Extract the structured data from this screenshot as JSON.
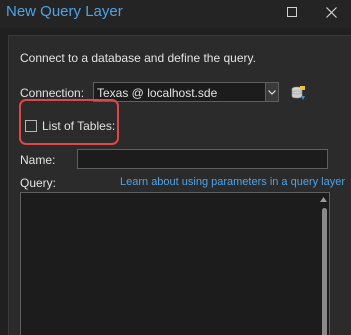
{
  "window": {
    "title": "New Query Layer"
  },
  "intro": {
    "text": "Connect to a database and define the query."
  },
  "connection": {
    "label": "Connection:",
    "value": "Texas @ localhost.sde",
    "icon": "database-connection-icon"
  },
  "list_of_tables": {
    "label": "List of Tables:",
    "checked": false
  },
  "name": {
    "label": "Name:",
    "value": ""
  },
  "query": {
    "label": "Query:",
    "link_text": "Learn about using parameters in a query layer",
    "value": ""
  },
  "colors": {
    "accent": "#4fa3e6",
    "highlight": "#e0454a",
    "background": "#2b2b2b"
  }
}
